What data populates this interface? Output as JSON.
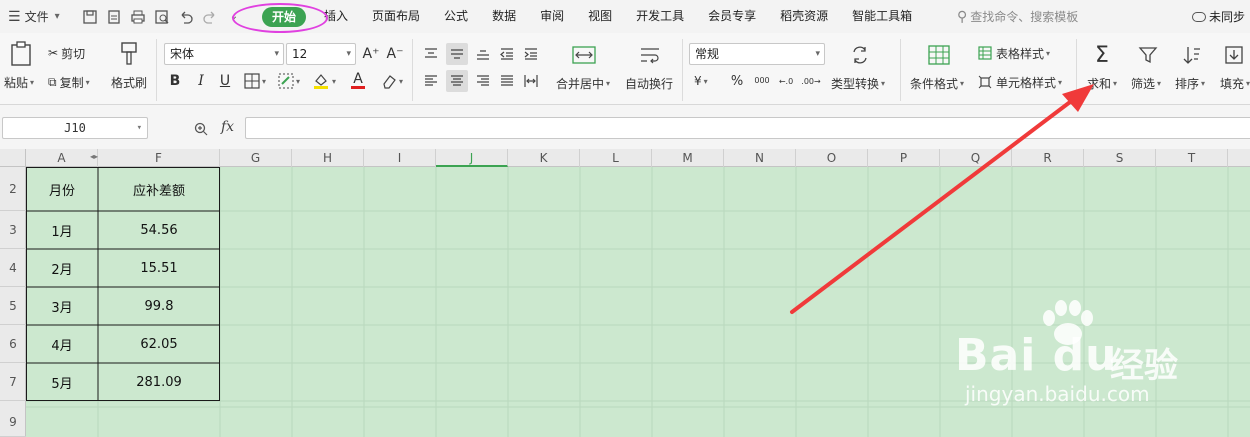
{
  "menubar": {
    "file_label": "文件",
    "tabs": [
      "开始",
      "插入",
      "页面布局",
      "公式",
      "数据",
      "审阅",
      "视图",
      "开发工具",
      "会员专享",
      "稻壳资源",
      "智能工具箱"
    ],
    "active_tab": "开始",
    "search_placeholder": "查找命令、搜索模板",
    "sync_label": "未同步"
  },
  "ribbon": {
    "paste": "粘贴",
    "cut": "剪切",
    "copy": "复制",
    "format_painter": "格式刷",
    "font_name": "宋体",
    "font_size": "12",
    "bold": "B",
    "italic": "I",
    "underline": "U",
    "font_color_glyph": "A",
    "merge_center": "合并居中",
    "wrap_text": "自动换行",
    "number_format": "常规",
    "percent": "%",
    "thousands": "000",
    "currency": "¥",
    "type_convert": "类型转换",
    "cond_format": "条件格式",
    "table_style": "表格样式",
    "cell_style": "单元格样式",
    "sum": "求和",
    "filter": "筛选",
    "sort": "排序",
    "fill": "填充"
  },
  "formula_bar": {
    "name_box": "J10",
    "fx": "fx"
  },
  "grid": {
    "columns": [
      "A",
      "F",
      "G",
      "H",
      "I",
      "J",
      "K",
      "L",
      "M",
      "N",
      "O",
      "P",
      "Q",
      "R",
      "S",
      "T"
    ],
    "active_column": "J",
    "rows": [
      "2",
      "3",
      "4",
      "5",
      "6",
      "7",
      "9"
    ]
  },
  "table": {
    "headers": [
      "月份",
      "应补差额"
    ],
    "rows": [
      [
        "1月",
        "54.56"
      ],
      [
        "2月",
        "15.51"
      ],
      [
        "3月",
        "99.8"
      ],
      [
        "4月",
        "62.05"
      ],
      [
        "5月",
        "281.09"
      ]
    ]
  },
  "watermark": {
    "brand": "Bai du",
    "cn": "经验",
    "url": "jingyan.baidu.com"
  },
  "colors": {
    "accent": "#3ca352",
    "annotation_ring": "#e040e0",
    "annotation_arrow": "#f03a3a",
    "sheet_bg": "#cce8cf"
  }
}
